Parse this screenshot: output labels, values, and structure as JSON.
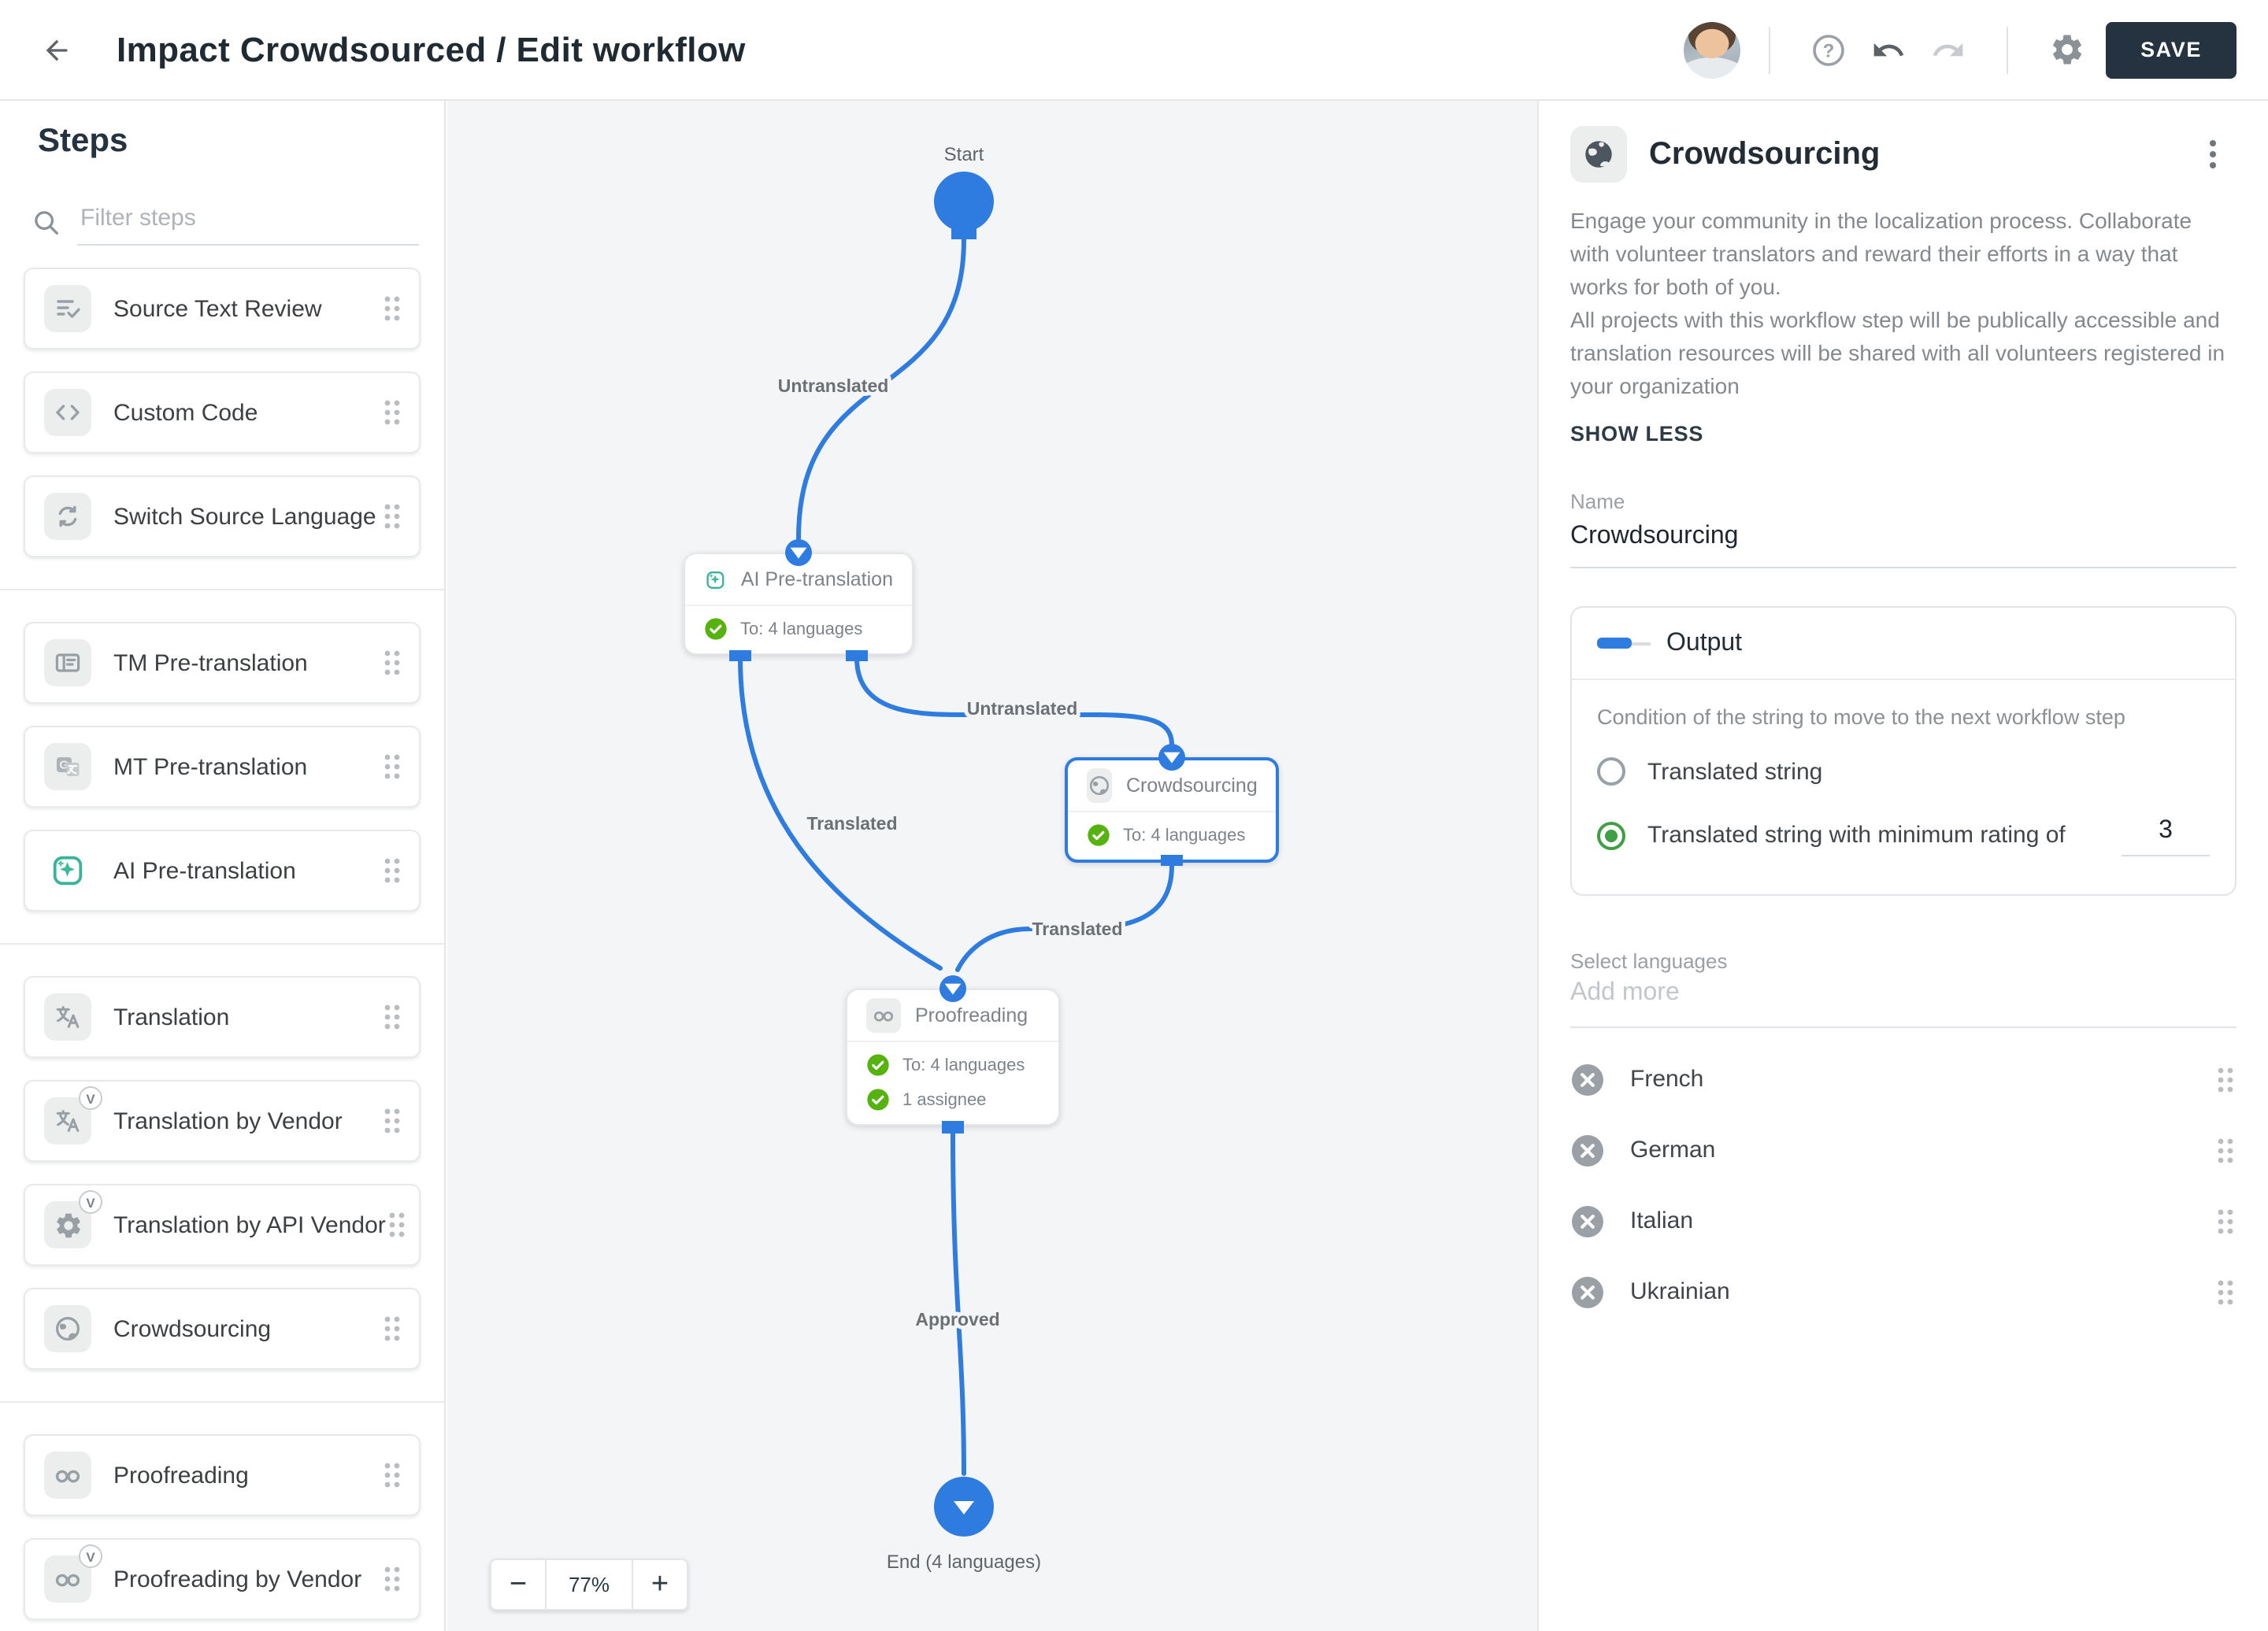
{
  "header": {
    "title": "Impact Crowdsourced / Edit workflow",
    "save_label": "SAVE"
  },
  "sidebar": {
    "title": "Steps",
    "filter_placeholder": "Filter steps",
    "vendor_badge": "V",
    "groups": [
      {
        "items": [
          {
            "label": "Source Text Review"
          },
          {
            "label": "Custom Code"
          },
          {
            "label": "Switch Source Language"
          }
        ]
      },
      {
        "items": [
          {
            "label": "TM Pre-translation"
          },
          {
            "label": "MT Pre-translation"
          },
          {
            "label": "AI Pre-translation"
          }
        ]
      },
      {
        "items": [
          {
            "label": "Translation"
          },
          {
            "label": "Translation by Vendor"
          },
          {
            "label": "Translation by API Vendor"
          },
          {
            "label": "Crowdsourcing"
          }
        ]
      },
      {
        "items": [
          {
            "label": "Proofreading"
          },
          {
            "label": "Proofreading by Vendor"
          }
        ]
      }
    ]
  },
  "canvas": {
    "start_label": "Start",
    "end_label": "End (4 languages)",
    "zoom_percent": "77%",
    "zoom_out": "−",
    "zoom_in": "+",
    "edges": {
      "start_to_ai": "Untranslated",
      "ai_to_crowdsourcing": "Untranslated",
      "ai_to_proofreading": "Translated",
      "crowdsourcing_to_proofreading": "Translated",
      "proofreading_to_end": "Approved"
    },
    "nodes": {
      "ai": {
        "title": "AI Pre-translation",
        "languages": "To: 4 languages"
      },
      "crowdsourcing": {
        "title": "Crowdsourcing",
        "languages": "To: 4 languages"
      },
      "proofreading": {
        "title": "Proofreading",
        "languages": "To: 4 languages",
        "assignees": "1 assignee"
      }
    }
  },
  "panel": {
    "title": "Crowdsourcing",
    "description_p1": "Engage your community in the localization process. Collaborate with volunteer translators and reward their efforts in a way that works for both of you.",
    "description_p2": "All projects with this workflow step will be publically accessible and translation resources will be shared with all volunteers registered in your organization",
    "show_less": "SHOW LESS",
    "name_label": "Name",
    "name_value": "Crowdsourcing",
    "output": {
      "title": "Output",
      "condition_label": "Condition of the string to move to the next workflow step",
      "option_translated": "Translated string",
      "option_min_rating": "Translated string with minimum rating of",
      "rating_value": "3"
    },
    "languages_label": "Select languages",
    "add_more_placeholder": "Add more",
    "languages": [
      {
        "name": "French"
      },
      {
        "name": "German"
      },
      {
        "name": "Italian"
      },
      {
        "name": "Ukrainian"
      }
    ]
  },
  "colors": {
    "accent_blue": "#2e7ce0",
    "success_green": "#56b30f",
    "radio_selected_green": "#3f9f44",
    "save_button_bg": "#253240"
  }
}
